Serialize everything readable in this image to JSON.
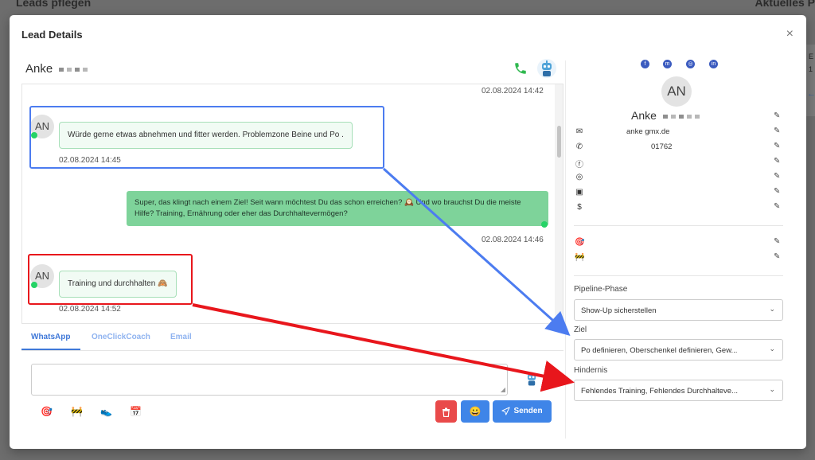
{
  "background": {
    "left_title": "Leads pflegen",
    "right_title": "Aktuelles P",
    "right_card_text_1": "E",
    "right_card_text_2": "1"
  },
  "modal": {
    "title": "Lead Details",
    "close_symbol": "×"
  },
  "chat": {
    "contact_name": "Anke",
    "messages": [
      {
        "timestamp_top": "02.08.2024 14:42"
      },
      {
        "avatar": "AN",
        "text": "Würde gerne etwas abnehmen und fitter werden. Problemzone Beine und Po .",
        "timestamp": "02.08.2024 14:45"
      },
      {
        "text": "Super, das klingt nach einem Ziel! Seit wann möchtest Du das schon erreichen? 🕰️ Und wo brauchst Du die meiste Hilfe? Training, Ernährung oder eher das Durchhaltevermögen?",
        "timestamp": "02.08.2024 14:46"
      },
      {
        "avatar": "AN",
        "text": "Training und durchhalten 🙈",
        "timestamp": "02.08.2024 14:52"
      }
    ]
  },
  "tabs": [
    {
      "label": "WhatsApp",
      "active": true
    },
    {
      "label": "OneClickCoach",
      "active": false
    },
    {
      "label": "Email",
      "active": false
    }
  ],
  "composer": {
    "placeholder": "",
    "send_label": "Senden",
    "quick_icons": [
      "🎯",
      "🚧",
      "👟",
      "📅"
    ],
    "emoji_button": "😀",
    "delete_icon": "trash-icon"
  },
  "profile": {
    "avatar": "AN",
    "name": "Anke",
    "email": "anke gmx.de",
    "phone": "01762",
    "dollar_symbol": "$",
    "goal_icon": "🎯",
    "obstacle_icon": "🚧",
    "socials": [
      "facebook-icon",
      "messenger-icon",
      "instagram-icon",
      "linkedin-icon"
    ]
  },
  "fields": {
    "pipeline_label": "Pipeline-Phase",
    "pipeline_value": "Show-Up sicherstellen",
    "ziel_label": "Ziel",
    "ziel_value": "Po definieren, Oberschenkel definieren, Gew...",
    "hindernis_label": "Hindernis",
    "hindernis_value": "Fehlendes Training, Fehlendes Durchhalteve..."
  },
  "colors": {
    "accent_blue": "#3f85e8",
    "whatsapp_green": "#25d366",
    "outgoing_bubble": "#7ed39a",
    "annotation_blue": "#4c7cf0",
    "annotation_red": "#e8161c",
    "delete_red": "#e94a4a"
  }
}
